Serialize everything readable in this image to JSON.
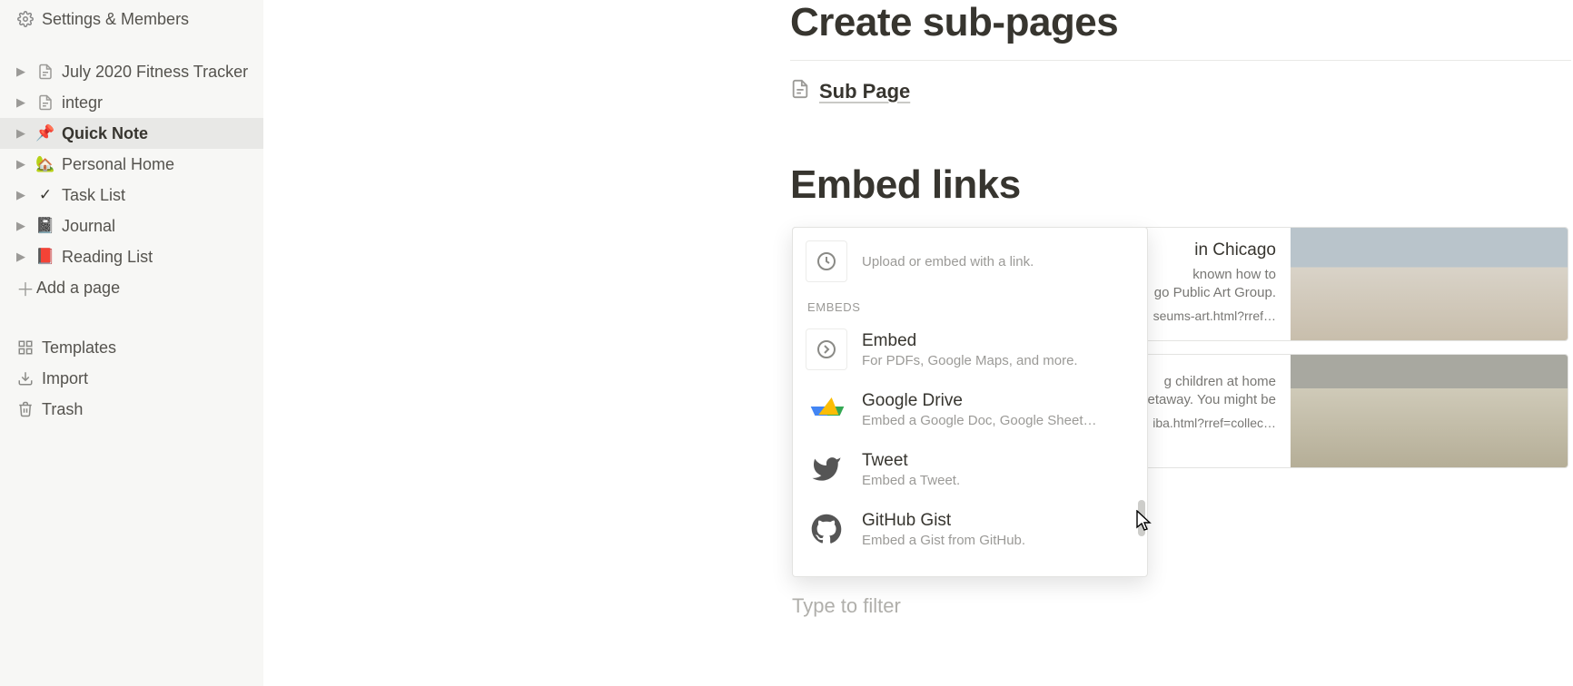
{
  "sidebar": {
    "settings_label": "Settings & Members",
    "pages": [
      {
        "label": "July 2020 Fitness Tracker",
        "icon": "page",
        "selected": false
      },
      {
        "label": "integr",
        "icon": "page",
        "selected": false
      },
      {
        "label": "Quick Note",
        "icon": "pin",
        "selected": true
      },
      {
        "label": "Personal Home",
        "icon": "house",
        "selected": false
      },
      {
        "label": "Task List",
        "icon": "check",
        "selected": false
      },
      {
        "label": "Journal",
        "icon": "book-gray",
        "selected": false
      },
      {
        "label": "Reading List",
        "icon": "book-red",
        "selected": false
      }
    ],
    "add_page_label": "Add a page",
    "bottom": {
      "templates": "Templates",
      "import": "Import",
      "trash": "Trash"
    }
  },
  "content": {
    "heading_create": "Create sub-pages",
    "subpage_label": "Sub Page",
    "heading_embed": "Embed links",
    "bookmarks": [
      {
        "title_fragment": "in Chicago",
        "desc_fragment1": "known how to",
        "desc_fragment2": "go Public Art Group.",
        "url_fragment": "seums-art.html?rref…"
      },
      {
        "title_fragment": "",
        "desc_fragment1": "g children at home",
        "desc_fragment2": "etaway. You might be",
        "url_fragment": "iba.html?rref=collec…"
      }
    ]
  },
  "popup": {
    "upload_desc": "Upload or embed with a link.",
    "section_label": "EMBEDS",
    "items": [
      {
        "title": "Embed",
        "desc": "For PDFs, Google Maps, and more.",
        "icon": "embed"
      },
      {
        "title": "Google Drive",
        "desc": "Embed a Google Doc, Google Sheet…",
        "icon": "gdrive"
      },
      {
        "title": "Tweet",
        "desc": "Embed a Tweet.",
        "icon": "twitter"
      },
      {
        "title": "GitHub Gist",
        "desc": "Embed a Gist from GitHub.",
        "icon": "github"
      }
    ],
    "filter_placeholder": "Type to filter"
  }
}
